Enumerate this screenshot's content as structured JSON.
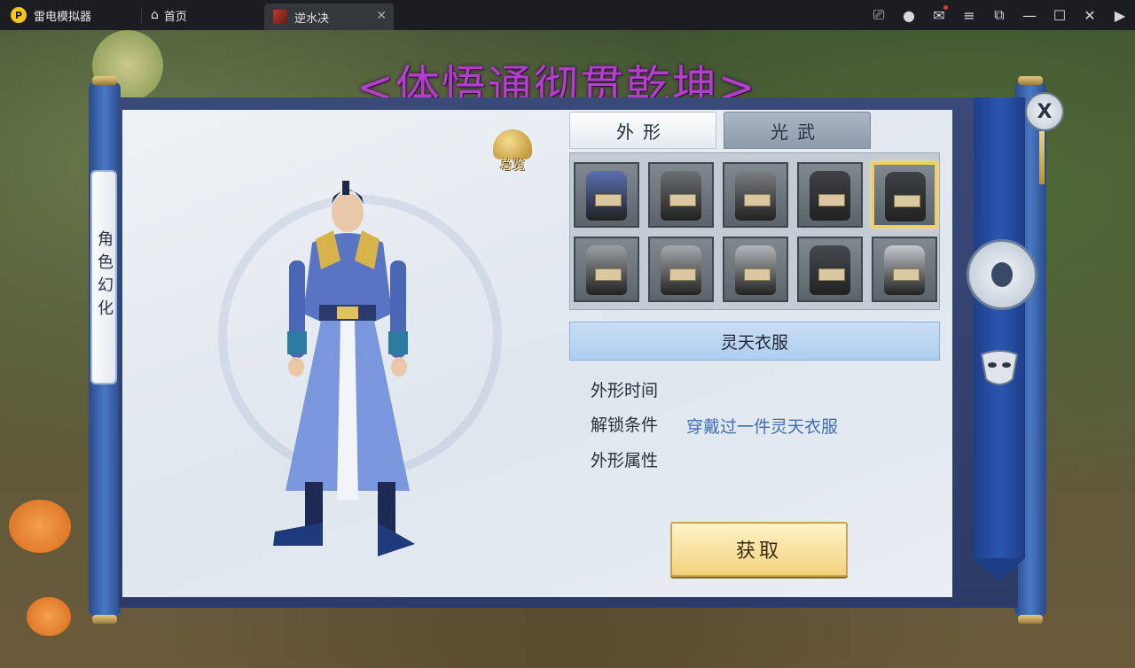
{
  "window": {
    "app_name": "雷电模拟器",
    "home_tab": "首页",
    "game_tab": "逆水决",
    "controls": [
      "gamepad-icon",
      "user-icon",
      "mail-icon",
      "menu-icon",
      "screenshot-icon",
      "minimize-icon",
      "maximize-icon",
      "close-icon",
      "fullscreen-icon"
    ]
  },
  "game": {
    "headline": "<体悟通彻贯乾坤>",
    "side_tab": "角色幻化",
    "overview_label": "总览",
    "tabs": [
      {
        "label": "外形",
        "active": true
      },
      {
        "label": "光武",
        "active": false
      }
    ],
    "slots": [
      {
        "color": "#5a6fb0",
        "selected": false,
        "icon": "blue-robe-icon"
      },
      {
        "color": "#6b6f74",
        "selected": false,
        "icon": "gray-robe-icon"
      },
      {
        "color": "#7a7e83",
        "selected": false,
        "icon": "gray-robe-icon"
      },
      {
        "color": "#3e4247",
        "selected": false,
        "icon": "dark-robe-icon"
      },
      {
        "color": "#3e4247",
        "selected": true,
        "icon": "dark-robe-icon"
      },
      {
        "color": "#9a9ea3",
        "selected": false,
        "icon": "silver-robe-icon"
      },
      {
        "color": "#a6aaae",
        "selected": false,
        "icon": "silver-robe-icon"
      },
      {
        "color": "#b2b6ba",
        "selected": false,
        "icon": "white-robe-icon"
      },
      {
        "color": "#45494e",
        "selected": false,
        "icon": "dark-robe-icon"
      },
      {
        "color": "#c4c8cc",
        "selected": false,
        "icon": "white-robe-icon"
      }
    ],
    "item_name": "灵天衣服",
    "details": {
      "time_label": "外形时间",
      "unlock_label": "解锁条件",
      "unlock_value": "穿戴过一件灵天衣服",
      "attr_label": "外形属性"
    },
    "get_button": "获取",
    "close_label": "X"
  }
}
